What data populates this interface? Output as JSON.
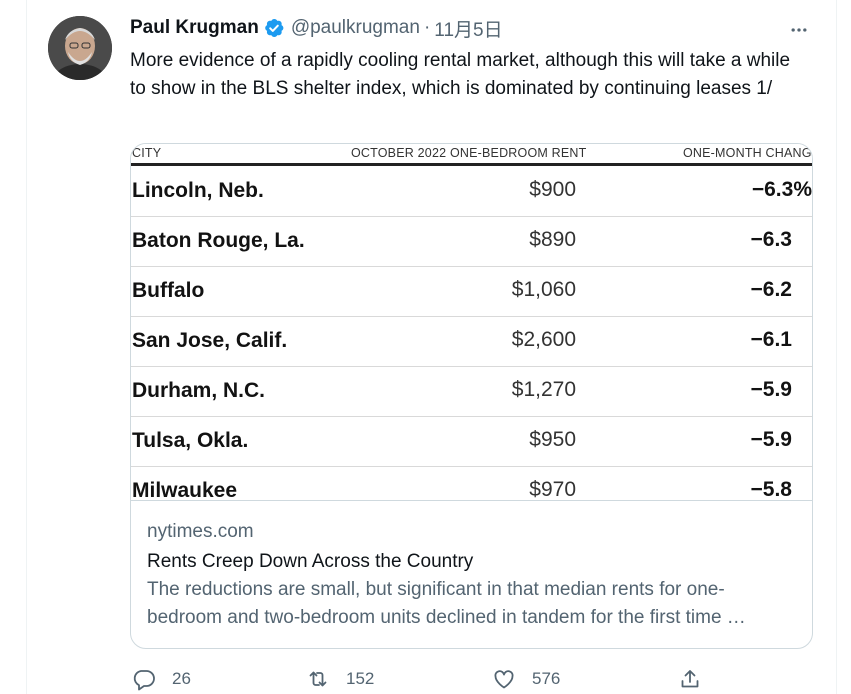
{
  "tweet": {
    "author_name": "Paul Krugman",
    "handle": "@paulkrugman",
    "separator": "·",
    "date": "11月5日",
    "text": "More evidence of a rapidly cooling rental market, although this will take a while to show in the BLS shelter index, which is dominated by continuing leases 1/"
  },
  "icons": {
    "verified": "verified-badge-icon",
    "more": "more-options-icon",
    "reply": "reply-icon",
    "retweet": "retweet-icon",
    "like": "like-icon",
    "share": "share-icon"
  },
  "card": {
    "table": {
      "headers": {
        "city": "CITY",
        "rent": "OCTOBER 2022 ONE-BEDROOM RENT",
        "change": "ONE-MONTH CHANGE"
      },
      "rows": [
        {
          "city": "Lincoln, Neb.",
          "rent": "$900",
          "change": "−6.3%"
        },
        {
          "city": "Baton Rouge, La.",
          "rent": "$890",
          "change": "−6.3"
        },
        {
          "city": "Buffalo",
          "rent": "$1,060",
          "change": "−6.2"
        },
        {
          "city": "San Jose, Calif.",
          "rent": "$2,600",
          "change": "−6.1"
        },
        {
          "city": "Durham, N.C.",
          "rent": "$1,270",
          "change": "−5.9"
        },
        {
          "city": "Tulsa, Okla.",
          "rent": "$950",
          "change": "−5.9"
        },
        {
          "city": "Milwaukee",
          "rent": "$970",
          "change": "−5.8"
        }
      ]
    },
    "domain": "nytimes.com",
    "title": "Rents Creep Down Across the Country",
    "description": "The reductions are small, but significant in that median rents for one-bedroom and two-bedroom units declined in tandem for the first time …"
  },
  "actions": {
    "reply_count": "26",
    "retweet_count": "152",
    "like_count": "576"
  },
  "colors": {
    "verified_blue": "#1d9bf0",
    "secondary_text": "#536471",
    "border": "#cfd9de"
  }
}
